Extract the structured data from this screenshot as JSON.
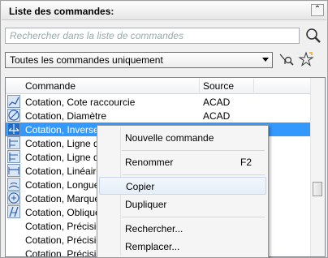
{
  "panel": {
    "title": "Liste des commandes:"
  },
  "search": {
    "placeholder": "Rechercher dans la liste de commandes"
  },
  "filter": {
    "selected": "Toutes les commandes uniquement"
  },
  "list": {
    "headers": {
      "command": "Commande",
      "source": "Source"
    },
    "rows": [
      {
        "command": "Cotation, Cote raccourcie",
        "source": "ACAD",
        "icon": "dim-jogged-icon"
      },
      {
        "command": "Cotation, Diamètre",
        "source": "ACAD",
        "icon": "dim-diameter-icon"
      },
      {
        "command": "Cotation, Inverser",
        "source": "",
        "icon": "dim-flip-icon",
        "selected": true
      },
      {
        "command": "Cotation, Ligne de",
        "source": "",
        "icon": "dim-baseline-icon"
      },
      {
        "command": "Cotation, Ligne de",
        "source": "",
        "icon": "dim-baseline-icon"
      },
      {
        "command": "Cotation, Linéaire",
        "source": "",
        "icon": "dim-linear-icon"
      },
      {
        "command": "Cotation, Longueu",
        "source": "",
        "icon": "dim-arc-icon"
      },
      {
        "command": "Cotation, Marque c",
        "source": "",
        "icon": "dim-center-icon"
      },
      {
        "command": "Cotation, Oblique",
        "source": "",
        "icon": "dim-oblique-icon"
      },
      {
        "command": "Cotation, Précision",
        "source": "",
        "icon": ""
      },
      {
        "command": "Cotation, Précision",
        "source": "",
        "icon": ""
      },
      {
        "command": "Cotation, Précision",
        "source": "",
        "icon": ""
      }
    ]
  },
  "context_menu": {
    "items": [
      {
        "label": "Nouvelle commande",
        "shortcut": ""
      },
      {
        "label": "Renommer",
        "shortcut": "F2"
      },
      {
        "label": "Copier",
        "shortcut": ""
      },
      {
        "label": "Dupliquer",
        "shortcut": ""
      },
      {
        "label": "Rechercher...",
        "shortcut": ""
      },
      {
        "label": "Remplacer...",
        "shortcut": ""
      }
    ]
  },
  "colors": {
    "selection": "#3399ff",
    "menu_highlight": "#e5eef9"
  }
}
